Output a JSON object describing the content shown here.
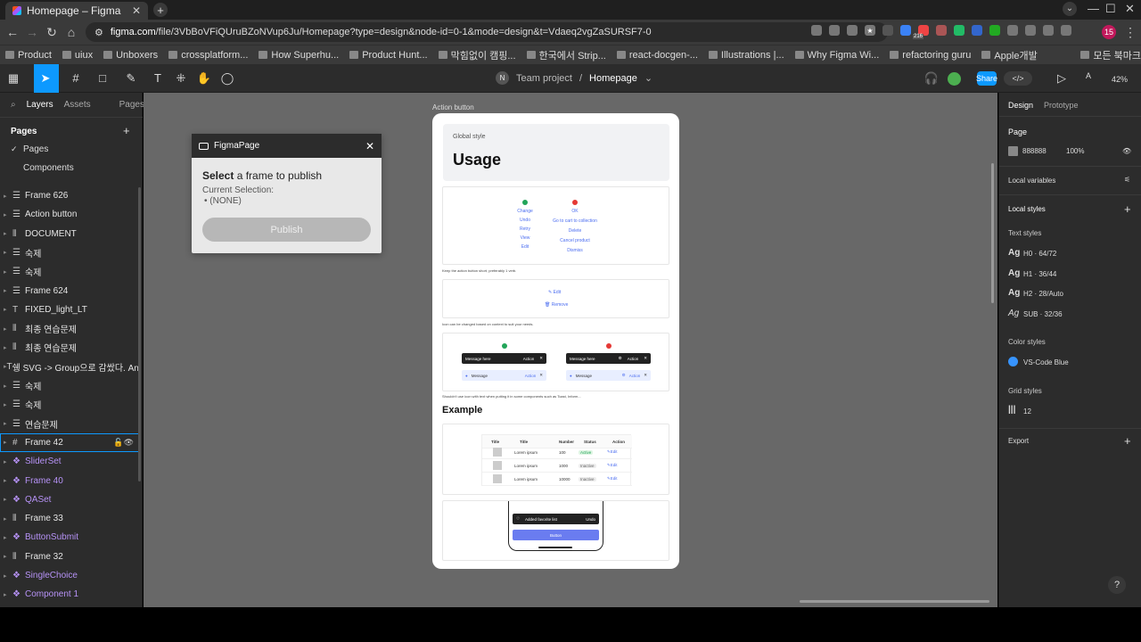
{
  "browser": {
    "tab_title": "Homepage – Figma",
    "url_host": "figma.com",
    "url_path": "/file/3VbBoVFiQUruBZoNVup6Ju/Homepage?type=design&node-id=0-1&mode=design&t=Vdaeq2vgZaSURSF7-0",
    "profile_badge": "15",
    "ext_badge": "216"
  },
  "bookmarks": [
    "Product",
    "uiux",
    "Unboxers",
    "crossplatform...",
    "How Superhu...",
    "Product Hunt...",
    "막힘없이 캠핑...",
    "한국에서 Strip...",
    "react-docgen-...",
    "Illustrations |...",
    "Why Figma Wi...",
    "refactoring guru",
    "Apple개발",
    "모든 북마크"
  ],
  "toolbar": {
    "team": "Team project",
    "sep": "/",
    "file": "Homepage",
    "avatar_initial": "N",
    "share": "Share",
    "zoom": "42%",
    "dev_label": "</>"
  },
  "left": {
    "tabs": {
      "layers": "Layers",
      "assets": "Assets",
      "pages": "Pages"
    },
    "pages_header": "Pages",
    "pages": [
      "Pages",
      "Components"
    ],
    "layers": [
      {
        "icon": "frame",
        "name": "Frame 626"
      },
      {
        "icon": "frame",
        "name": "Action button"
      },
      {
        "icon": "grid",
        "name": "DOCUMENT"
      },
      {
        "icon": "frame",
        "name": "숙제"
      },
      {
        "icon": "frame",
        "name": "숙제"
      },
      {
        "icon": "frame",
        "name": "Frame 624"
      },
      {
        "icon": "text",
        "name": "FIXED_light_LT"
      },
      {
        "icon": "grid",
        "name": "최종 연습문제"
      },
      {
        "icon": "grid",
        "name": "최종 연습문제"
      },
      {
        "icon": "text",
        "name": "쉥 SVG -> Group으로 감쌌다. Angle..."
      },
      {
        "icon": "frame",
        "name": "숙제"
      },
      {
        "icon": "frame",
        "name": "숙제"
      },
      {
        "icon": "frame",
        "name": "연습문제"
      },
      {
        "icon": "hash",
        "name": "Frame 42"
      },
      {
        "icon": "comp",
        "name": "SliderSet"
      },
      {
        "icon": "comp",
        "name": "Frame 40"
      },
      {
        "icon": "comp",
        "name": "QASet"
      },
      {
        "icon": "grid",
        "name": "Frame 33"
      },
      {
        "icon": "comp",
        "name": "ButtonSubmit"
      },
      {
        "icon": "grid",
        "name": "Frame 32"
      },
      {
        "icon": "comp",
        "name": "SingleChoice"
      },
      {
        "icon": "comp",
        "name": "Component 1"
      }
    ]
  },
  "plugin": {
    "title": "FigmaPage",
    "select_bold": "Select",
    "select_rest": " a frame to publish",
    "current": "Current Selection:",
    "none": "• (NONE)",
    "publish": "Publish"
  },
  "frame": {
    "label": "Action button",
    "global_style": "Global style",
    "usage": "Usage",
    "good_links": [
      "Change",
      "Undo",
      "Retry",
      "View",
      "Edit"
    ],
    "bad_links": [
      "OK",
      "Go to cart to collection",
      "Delete",
      "Cancel product",
      "Dismiss"
    ],
    "caption1": "Keep the action button short, preferably 1 verb.",
    "edit": "Edit",
    "remove": "Remove",
    "caption2": "Icon can be changed based on context to suit your needs.",
    "message_here": "Message here",
    "action": "Action",
    "message": "Message",
    "caption3": "Shouldn't use icon with text when putting it in some components such as Toast, Inform...",
    "example": "Example",
    "table_headers": [
      "Title",
      "Title",
      "Number",
      "Status",
      "Action"
    ],
    "rows": [
      {
        "title": "Lorem ipsum",
        "num": "100",
        "status": "Active"
      },
      {
        "title": "Lorem ipsum",
        "num": "1000",
        "status": "Inactive"
      },
      {
        "title": "Lorem ipsum",
        "num": "10000",
        "status": "Inactive"
      }
    ],
    "toast": "Added favorite list",
    "undo": "Undo",
    "button": "Button"
  },
  "right": {
    "tabs": {
      "design": "Design",
      "prototype": "Prototype"
    },
    "page": "Page",
    "page_color": "888888",
    "page_opacity": "100%",
    "local_variables": "Local variables",
    "local_styles": "Local styles",
    "text_styles": "Text styles",
    "text_items": [
      {
        "ag": "Ag",
        "name": "H0 · 64/72"
      },
      {
        "ag": "Ag",
        "name": "H1 · 36/44"
      },
      {
        "ag": "Ag",
        "name": "H2 · 28/Auto"
      },
      {
        "ag": "Ag",
        "name": "SUB · 32/36"
      }
    ],
    "color_styles": "Color styles",
    "color_name": "VS-Code Blue",
    "grid_styles": "Grid styles",
    "grid_value": "12",
    "export": "Export"
  },
  "colors": {
    "accent": "#0d99ff",
    "component": "#b692f6",
    "canvas": "#686868"
  }
}
